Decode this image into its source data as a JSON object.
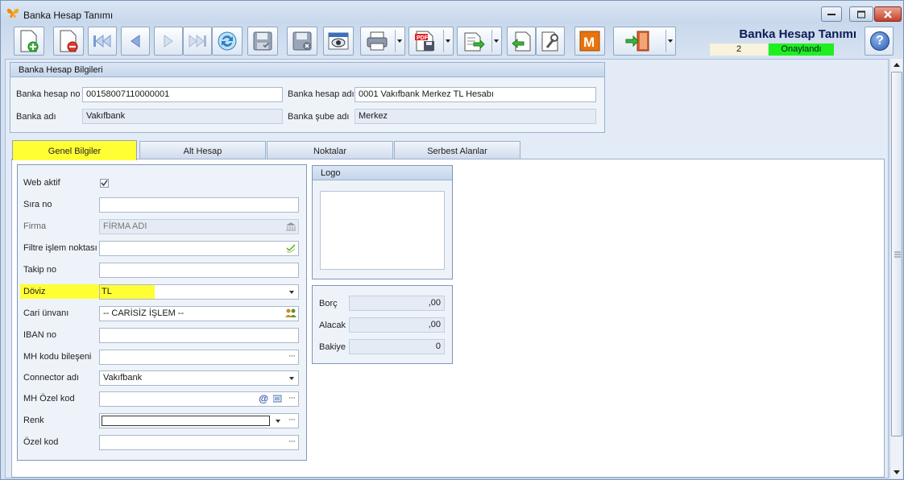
{
  "window": {
    "title": "Banka Hesap Tanımı"
  },
  "header": {
    "title": "Banka Hesap Tanımı",
    "number": "2",
    "status": "Onaylandı",
    "status_color": "#1ef01e"
  },
  "bank_group": {
    "caption": "Banka Hesap Bilgileri",
    "account_no_label": "Banka hesap no",
    "account_no_value": "00158007110000001",
    "account_name_label": "Banka hesap adı",
    "account_name_value": "0001 Vakıfbank Merkez TL Hesabı",
    "bank_name_label": "Banka adı",
    "bank_name_value": "Vakıfbank",
    "branch_label": "Banka şube adı",
    "branch_value": "Merkez"
  },
  "tabs": [
    {
      "label": "Genel Bilgiler",
      "active": true
    },
    {
      "label": "Alt Hesap"
    },
    {
      "label": "Noktalar"
    },
    {
      "label": "Serbest Alanlar"
    }
  ],
  "form": {
    "web_active": {
      "label": "Web aktif",
      "checked": true
    },
    "sira_no": {
      "label": "Sıra no",
      "value": ""
    },
    "firma": {
      "label": "Firma",
      "value": "FİRMA ADI"
    },
    "filtre": {
      "label": "Filtre işlem noktası",
      "value": ""
    },
    "takip": {
      "label": "Takip no",
      "value": ""
    },
    "doviz": {
      "label": "Döviz",
      "value": "TL"
    },
    "cari": {
      "label": "Cari ünvanı",
      "value": "-- CARİSİZ İŞLEM --"
    },
    "iban": {
      "label": "IBAN no",
      "value": ""
    },
    "mh_kodu": {
      "label": "MH kodu bileşeni",
      "value": ""
    },
    "connector": {
      "label": "Connector adı",
      "value": "Vakıfbank"
    },
    "mh_ozel": {
      "label": "MH Özel kod",
      "value": ""
    },
    "renk": {
      "label": "Renk",
      "value": ""
    },
    "ozel": {
      "label": "Özel kod",
      "value": ""
    }
  },
  "logo": {
    "caption": "Logo"
  },
  "totals": {
    "borc": {
      "label": "Borç",
      "value": ",00"
    },
    "alacak": {
      "label": "Alacak",
      "value": ",00"
    },
    "bakiye": {
      "label": "Bakiye",
      "value": "0"
    }
  },
  "toolbar_icons": [
    "new-document-icon",
    "delete-document-icon",
    "first-record-icon",
    "previous-record-icon",
    "next-record-icon",
    "last-record-icon",
    "refresh-icon",
    "save-icon",
    "save-close-icon",
    "preview-icon",
    "print-icon",
    "pdf-export-icon",
    "export-icon",
    "import-icon",
    "settings-icon",
    "m-icon",
    "exit-icon"
  ],
  "colors": {
    "highlight": "#ffff33",
    "accent_m": "#e8730c"
  }
}
